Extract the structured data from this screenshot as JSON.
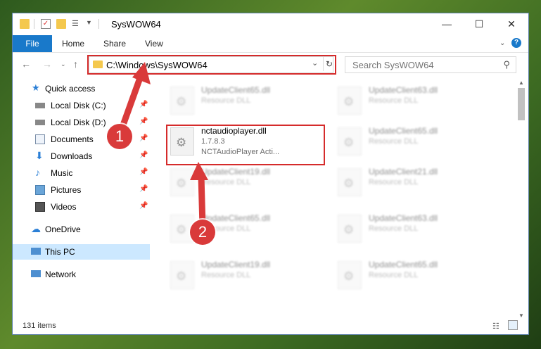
{
  "window": {
    "title": "SysWOW64",
    "ribbon_tabs": [
      "File",
      "Home",
      "Share",
      "View"
    ],
    "help": "?"
  },
  "address": {
    "path": "C:\\Windows\\SysWOW64",
    "search_placeholder": "Search SysWOW64"
  },
  "sidebar": {
    "items": [
      {
        "label": "Quick access",
        "icon": "star-icon"
      },
      {
        "label": "Local Disk (C:)",
        "icon": "drive-icon"
      },
      {
        "label": "Local Disk (D:)",
        "icon": "drive-icon"
      },
      {
        "label": "Documents",
        "icon": "documents-icon"
      },
      {
        "label": "Downloads",
        "icon": "download-icon"
      },
      {
        "label": "Music",
        "icon": "music-icon"
      },
      {
        "label": "Pictures",
        "icon": "pictures-icon"
      },
      {
        "label": "Videos",
        "icon": "videos-icon"
      },
      {
        "label": "OneDrive",
        "icon": "cloud-icon"
      },
      {
        "label": "This PC",
        "icon": "computer-icon"
      },
      {
        "label": "Network",
        "icon": "network-icon"
      }
    ]
  },
  "files": [
    {
      "name": "UpdateClient65.dll",
      "sub": "Resource DLL"
    },
    {
      "name": "UpdateClient63.dll",
      "sub": "Resource DLL"
    },
    {
      "name": "nctaudioplayer.dll",
      "sub": "1.7.8.3",
      "sub2": "NCTAudioPlayer Acti..."
    },
    {
      "name": "UpdateClient65.dll",
      "sub": "Resource DLL"
    },
    {
      "name": "UpdateClient19.dll",
      "sub": "Resource DLL"
    },
    {
      "name": "UpdateClient21.dll",
      "sub": "Resource DLL"
    },
    {
      "name": "UpdateClient65.dll",
      "sub": "Resource DLL"
    },
    {
      "name": "UpdateClient63.dll",
      "sub": "Resource DLL"
    },
    {
      "name": "UpdateClient19.dll",
      "sub": "Resource DLL"
    },
    {
      "name": "UpdateClient65.dll",
      "sub": "Resource DLL"
    }
  ],
  "status": {
    "count": "131 items"
  },
  "annotations": {
    "step1": "1",
    "step2": "2",
    "color": "#d93a3a"
  }
}
